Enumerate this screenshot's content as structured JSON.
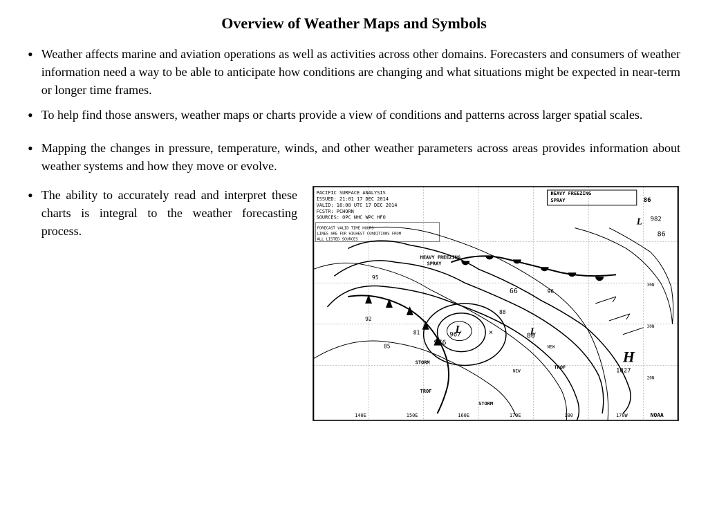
{
  "title": "Overview of Weather Maps and Symbols",
  "bullets": [
    {
      "id": "bullet-1",
      "text": "Weather affects marine and aviation operations as well as activities across other domains. Forecasters and consumers of weather information need a way to be able to anticipate how conditions are changing and what situations might be expected in near-term or longer time frames."
    },
    {
      "id": "bullet-2",
      "text": "To help find those answers, weather maps or charts provide a view of conditions and patterns across larger spatial scales."
    },
    {
      "id": "bullet-3",
      "text": "Mapping the changes in pressure, temperature, winds, and other weather parameters across areas provides information about weather systems and how they move or evolve."
    }
  ],
  "bottom_bullet": {
    "id": "bullet-4",
    "text": "The ability to accurately read and interpret these charts is integral to the weather forecasting process."
  },
  "map": {
    "title": "PACIFIC SURFACE ANALYSIS",
    "issued": "21:01 17 DEC 2014",
    "valid": "18:00 UTC 17 DEC 2014",
    "fcstr": "PCHORN",
    "sources": "OPC NHC WPC HFO",
    "heavy_freezing_label": "HEAVY FREEZING",
    "spray_label": "SPRAY",
    "noaa_label": "NOAA",
    "pressure_labels": [
      "976",
      "967",
      "982",
      "1027",
      "86",
      "66",
      "80"
    ],
    "storm_label": "STORM",
    "trof_label": "TROF",
    "high_label": "H",
    "low_label": "L"
  }
}
